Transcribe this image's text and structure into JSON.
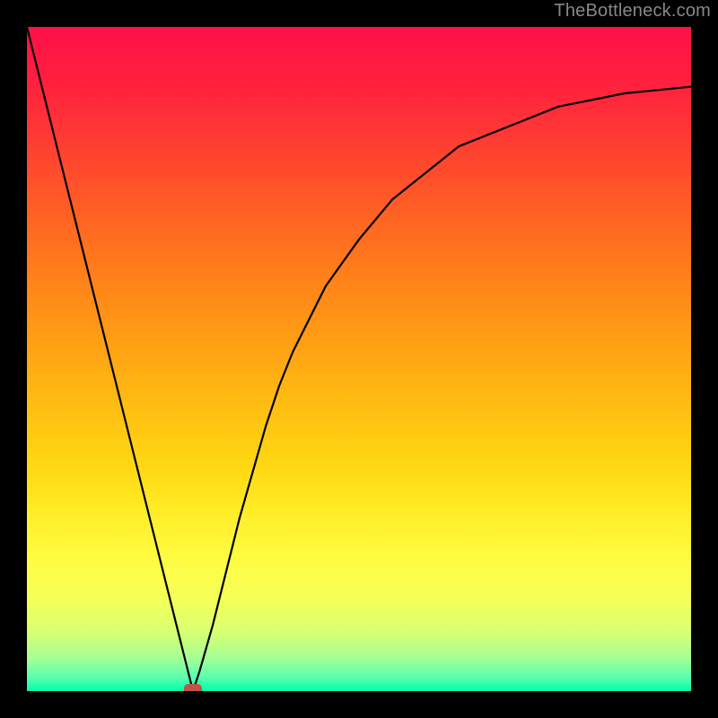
{
  "watermark": "TheBottleneck.com",
  "chart_data": {
    "type": "line",
    "title": "",
    "xlabel": "",
    "ylabel": "",
    "xlim": [
      0,
      100
    ],
    "ylim": [
      0,
      100
    ],
    "legend": false,
    "grid": false,
    "background_gradient": {
      "direction": "vertical",
      "stops": [
        {
          "pos": 0,
          "color": "#ff1049"
        },
        {
          "pos": 50,
          "color": "#ffb012"
        },
        {
          "pos": 80,
          "color": "#fff820"
        },
        {
          "pos": 100,
          "color": "#00ffa6"
        }
      ]
    },
    "series": [
      {
        "name": "bottleneck-curve",
        "x": [
          0,
          2,
          4,
          6,
          8,
          10,
          12,
          14,
          16,
          18,
          20,
          22,
          24,
          25,
          26,
          28,
          30,
          32,
          34,
          36,
          38,
          40,
          45,
          50,
          55,
          60,
          65,
          70,
          75,
          80,
          85,
          90,
          95,
          100
        ],
        "y": [
          100,
          92,
          84,
          76,
          68,
          60,
          52,
          44,
          36,
          28,
          20,
          12,
          4,
          0,
          3,
          10,
          18,
          26,
          33,
          40,
          46,
          51,
          61,
          68,
          74,
          78,
          82,
          84,
          86,
          88,
          89,
          90,
          90.5,
          91
        ],
        "note": "Piecewise curve: steep linear descent to a minimum at x≈25 (y≈0), then a concave rise asymptoting near y≈91."
      }
    ],
    "marker": {
      "name": "minimum-point",
      "x": 25,
      "y": 0,
      "shape": "rounded-rect",
      "color": "#c25148"
    }
  }
}
